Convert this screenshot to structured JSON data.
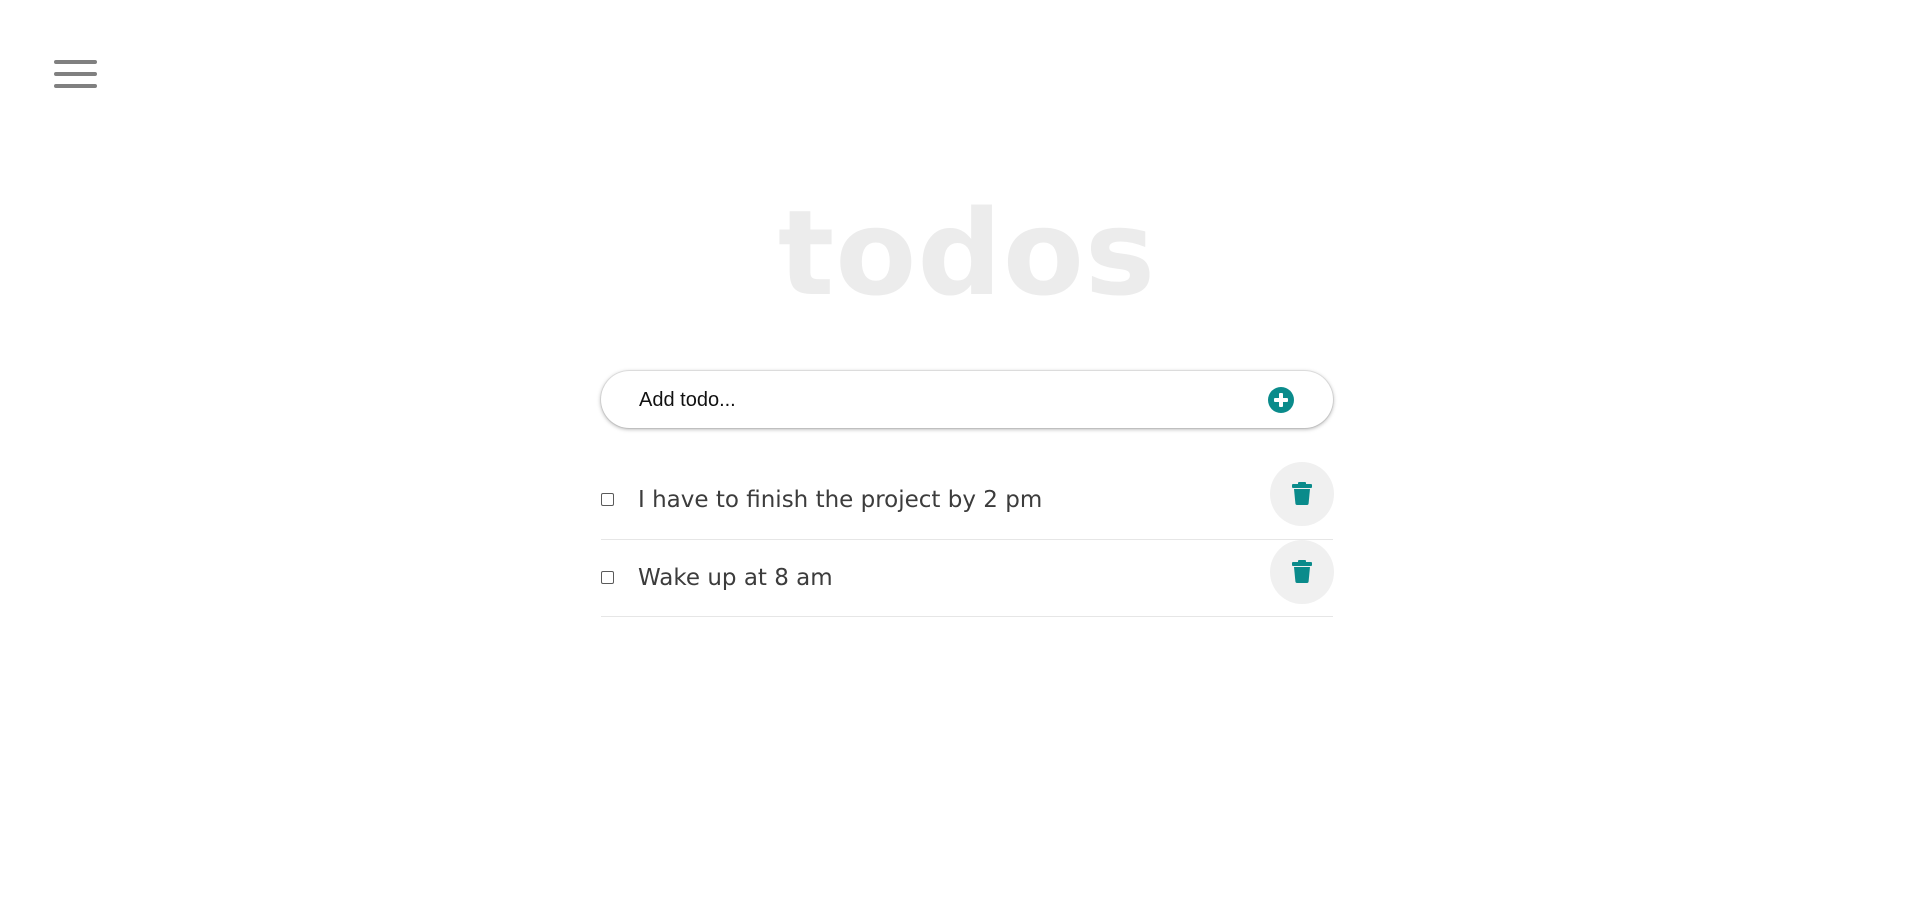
{
  "app": {
    "title": "todos"
  },
  "add_form": {
    "placeholder": "Add todo...",
    "value": "",
    "add_icon": "plus-circle-icon"
  },
  "menu": {
    "icon": "hamburger-menu-icon"
  },
  "todos": [
    {
      "text": "I have to finish the project by 2 pm",
      "completed": false,
      "delete_icon": "trash-icon"
    },
    {
      "text": "Wake up at 8 am",
      "completed": false,
      "delete_icon": "trash-icon"
    }
  ],
  "colors": {
    "accent": "#0a8b8b",
    "title": "#ececec",
    "text": "#3c3c3c",
    "menu": "#808080",
    "delete_bg": "#f0f0f0"
  }
}
